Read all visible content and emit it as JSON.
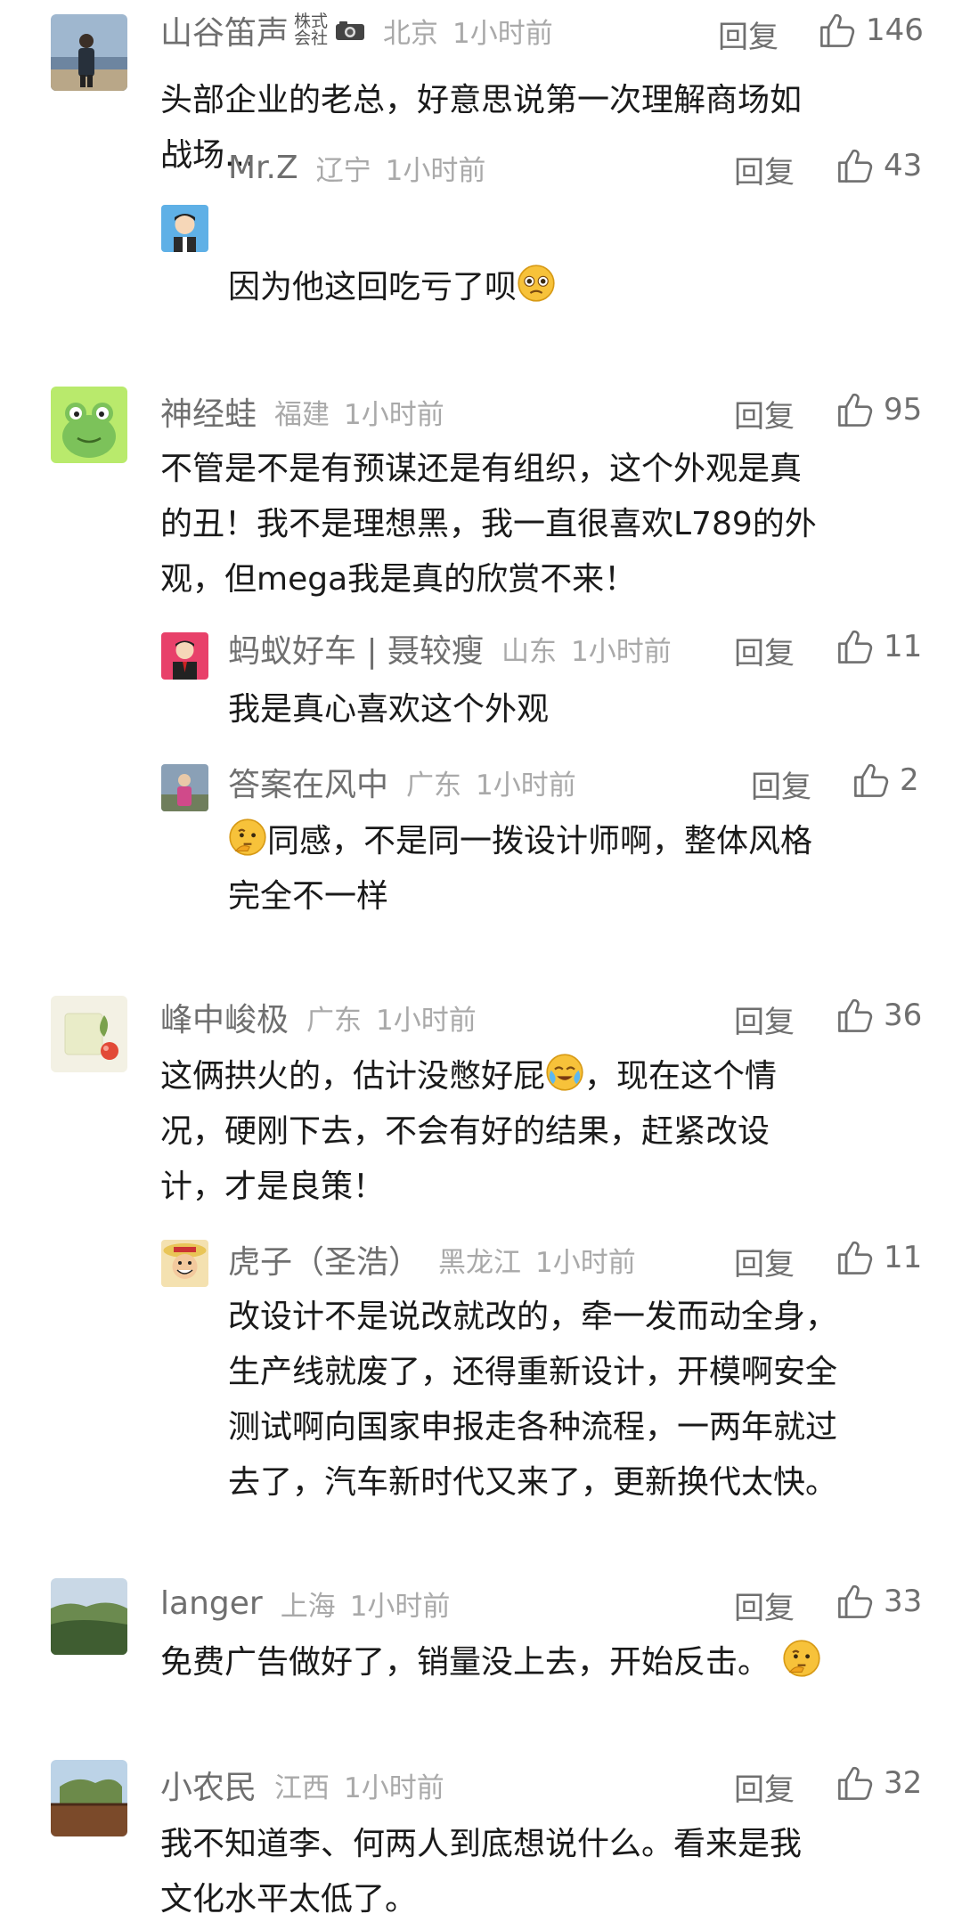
{
  "labels": {
    "reply": "回复"
  },
  "comments": {
    "c1": {
      "user": "山谷笛声",
      "tag": "株式会社",
      "camera_icon": "camera-icon",
      "location": "北京",
      "time": "1小时前",
      "likes": "146",
      "text": [
        "头部企业的老总，好意思说第一次理解商场如",
        "战场..."
      ],
      "replies": {
        "r1": {
          "user": "Mr.Z",
          "location": "辽宁",
          "time": "1小时前",
          "likes": "43",
          "text": [
            "因为他这回吃亏了呗"
          ],
          "emoji": "pleading-face-emoji"
        }
      }
    },
    "c2": {
      "user": "神经蛙",
      "location": "福建",
      "time": "1小时前",
      "likes": "95",
      "text": [
        "不管是不是有预谋还是有组织，这个外观是真",
        "的丑！我不是理想黑，我一直很喜欢L789的外",
        "观，但mega我是真的欣赏不来！"
      ],
      "replies": {
        "r1": {
          "user": "蚂蚁好车 | 聂较瘦",
          "location": "山东",
          "time": "1小时前",
          "likes": "11",
          "text": [
            "我是真心喜欢这个外观"
          ]
        },
        "r2": {
          "user": "答案在风中",
          "location": "广东",
          "time": "1小时前",
          "likes": "2",
          "emoji": "thinking-face-emoji",
          "text": [
            "同感，不是同一拨设计师啊，整体风格",
            "完全不一样"
          ]
        }
      }
    },
    "c3": {
      "user": "峰中峻极",
      "location": "广东",
      "time": "1小时前",
      "likes": "36",
      "text_before_emoji": "这俩拱火的，估计没憋好屁",
      "emoji": "crying-face-emoji",
      "text_after_emoji": "，现在这个情",
      "text": [
        "况，硬刚下去，不会有好的结果，赶紧改设",
        "计，才是良策！"
      ],
      "replies": {
        "r1": {
          "user": "虎子（圣浩）",
          "location": "黑龙江",
          "time": "1小时前",
          "likes": "11",
          "text": [
            "改设计不是说改就改的，牵一发而动全身，",
            "生产线就废了，还得重新设计，开模啊安全",
            "测试啊向国家申报走各种流程，一两年就过",
            "去了，汽车新时代又来了，更新换代太快。"
          ]
        }
      }
    },
    "c4": {
      "user": "langer",
      "location": "上海",
      "time": "1小时前",
      "likes": "33",
      "text": [
        "免费广告做好了，销量没上去，开始反击。"
      ],
      "emoji": "thinking-face-emoji"
    },
    "c5": {
      "user": "小农民",
      "location": "江西",
      "time": "1小时前",
      "likes": "32",
      "text": [
        "我不知道李、何两人到底想说什么。看来是我",
        "文化水平太低了。"
      ]
    }
  }
}
